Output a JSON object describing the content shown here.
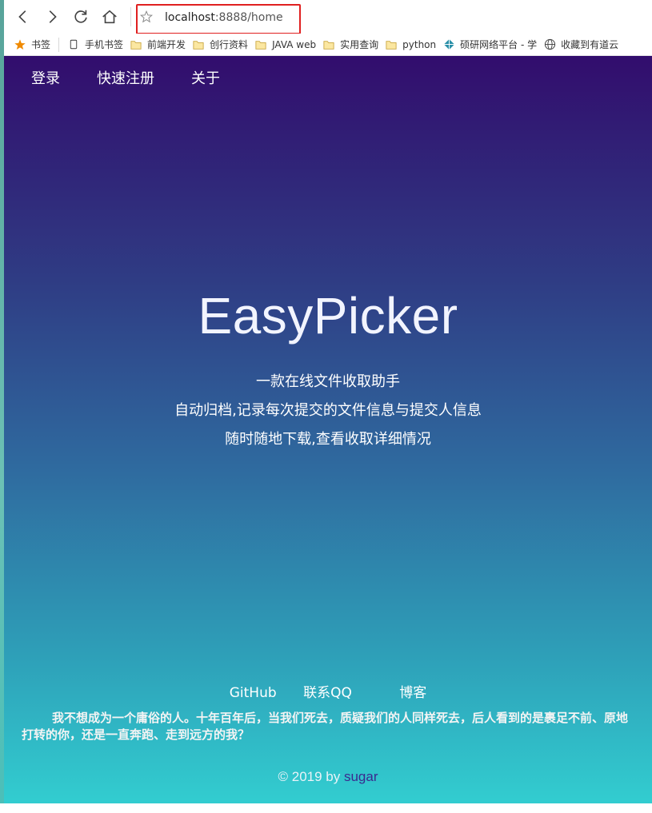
{
  "browser": {
    "address": {
      "host": "localhost",
      "rest": ":8888/home"
    },
    "bookmarks": [
      {
        "label": "书签",
        "icon": "star-icon"
      },
      {
        "label": "手机书签",
        "icon": "phone-icon"
      },
      {
        "label": "前端开发",
        "icon": "folder-icon"
      },
      {
        "label": "创行资料",
        "icon": "folder-icon"
      },
      {
        "label": "JAVA web",
        "icon": "folder-icon"
      },
      {
        "label": "实用查询",
        "icon": "folder-icon"
      },
      {
        "label": "python",
        "icon": "folder-icon"
      },
      {
        "label": "硕研网络平台 - 学",
        "icon": "compass-icon"
      },
      {
        "label": "收藏到有道云",
        "icon": "globe-icon"
      }
    ]
  },
  "nav": {
    "login": "登录",
    "register": "快速注册",
    "about": "关于"
  },
  "hero": {
    "title": "EasyPicker",
    "lines": [
      "一款在线文件收取助手",
      "自动归档,记录每次提交的文件信息与提交人信息",
      "随时随地下载,查看收取详细情况"
    ]
  },
  "footer": {
    "links": {
      "github": "GitHub",
      "qq": "联系QQ",
      "blog": "博客"
    },
    "quote": "我不想成为一个庸俗的人。十年百年后，当我们死去，质疑我们的人同样死去，后人看到的是裹足不前、原地打转的你，还是一直奔跑、走到远方的我？",
    "copyright_prefix": "© 2019 by ",
    "author": "sugar"
  },
  "colors": {
    "gradient_top": "#320d6d",
    "gradient_bottom": "#32cdd0",
    "address_highlight": "#e02020",
    "author_link": "#3b2a8f"
  }
}
